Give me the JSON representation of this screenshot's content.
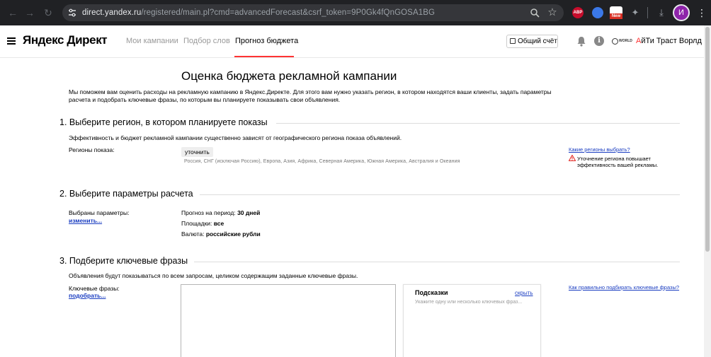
{
  "browser": {
    "url_host": "direct.yandex.ru",
    "url_path": "/registered/main.pl?cmd=advancedForecast&csrf_token=9P0Gk4fQnGOSA1BG",
    "ext_abp_label": "ABP",
    "ext_new_label": "New",
    "profile_initial": "И"
  },
  "header": {
    "logo": "Яндекс Директ",
    "tabs": [
      {
        "label": "Мои кампании"
      },
      {
        "label": "Подбор слов"
      },
      {
        "label": "Прогноз бюджета"
      }
    ],
    "balance_label": "Общий счёт",
    "world_logo_text": "WORLD",
    "user_first": "А",
    "user_rest": "йТи Траст Ворлд"
  },
  "page": {
    "title": "Оценка бюджета рекламной кампании",
    "intro": "Мы поможем вам оценить расходы на рекламную кампанию в Яндекс.Директе. Для этого вам нужно указать регион, в котором находятся ваши клиенты, задать параметры расчета и подобрать ключевые фразы, по которым вы планируете показывать свои объявления."
  },
  "section1": {
    "title": "1. Выберите регион, в котором планируете показы",
    "desc": "Эффективность и бюджет рекламной кампании существенно зависят от географического региона показа объявлений.",
    "regions_label": "Регионы показа:",
    "refine_button": "уточнить",
    "regions_list": "Россия, СНГ (исключая Россию), Европа, Азия, Африка, Северная Америка, Южная Америка, Австралия и Океания",
    "help_link": "Какие регионы выбрать?",
    "warning": "Уточнение региона повышает эффективность вашей рекламы."
  },
  "section2": {
    "title": "2. Выберите параметры расчета",
    "selected_label": "Выбраны параметры:",
    "change_link": "изменить...",
    "period_label": "Прогноз на период:",
    "period_value": "30 дней",
    "platforms_label": "Площадки:",
    "platforms_value": "все",
    "currency_label": "Валюта:",
    "currency_value": "российские рубли"
  },
  "section3": {
    "title": "3. Подберите ключевые фразы",
    "desc": "Объявления будут показываться по всем запросам, целиком содержащим заданные ключевые фразы.",
    "keywords_label": "Ключевые фразы:",
    "pick_link": "подобрать...",
    "keywords_value": "",
    "hints_title": "Подсказки",
    "hints_hide": "скрыть",
    "hints_text": "Укажите одну или несколько ключевых фраз...",
    "help_link": "Как правильно подбирать ключевые фразы?"
  },
  "colors": {
    "accent_red": "#ff3333",
    "link_blue": "#1a3dc1",
    "chrome_bg": "#202124"
  }
}
